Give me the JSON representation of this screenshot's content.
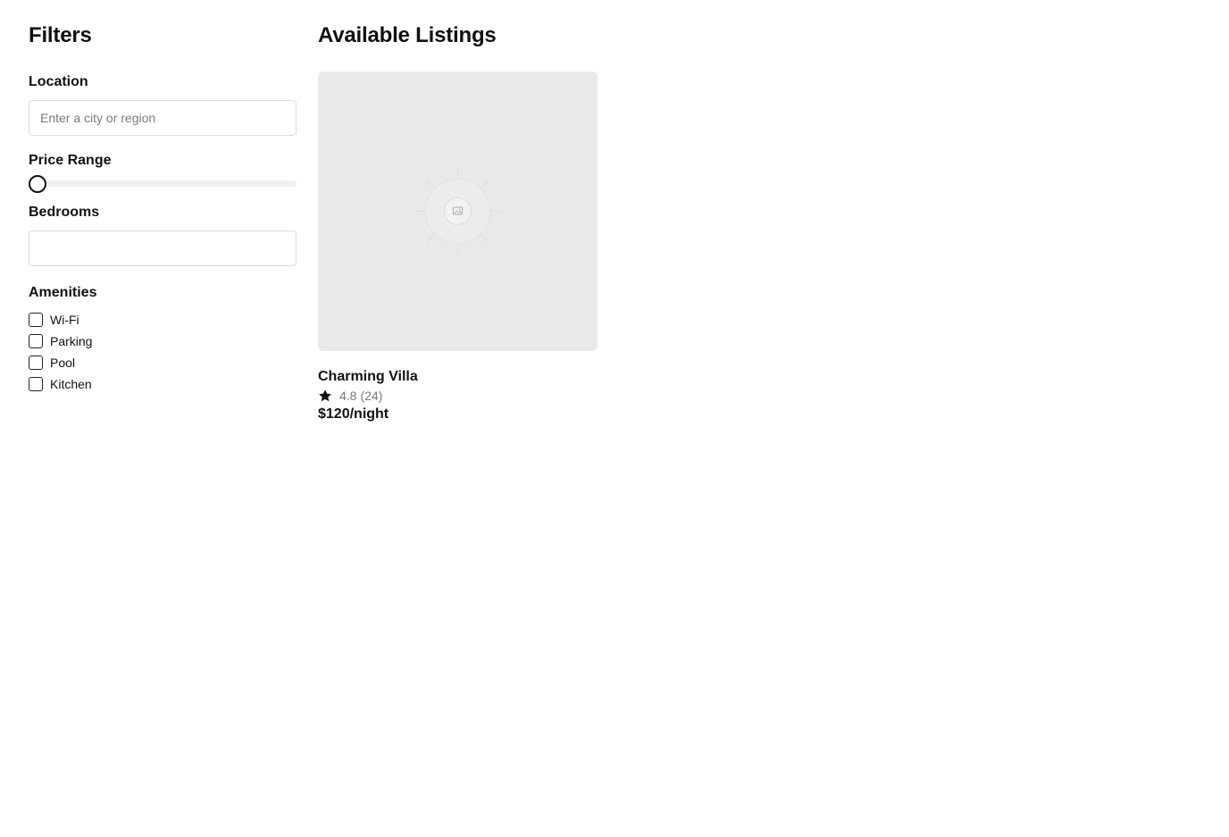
{
  "sidebar": {
    "title": "Filters",
    "location": {
      "label": "Location",
      "placeholder": "Enter a city or region",
      "value": ""
    },
    "price_range": {
      "label": "Price Range",
      "value_fraction": 0.0
    },
    "bedrooms": {
      "label": "Bedrooms",
      "value": ""
    },
    "amenities": {
      "label": "Amenities",
      "items": [
        {
          "label": "Wi-Fi",
          "checked": false
        },
        {
          "label": "Parking",
          "checked": false
        },
        {
          "label": "Pool",
          "checked": false
        },
        {
          "label": "Kitchen",
          "checked": false
        }
      ]
    }
  },
  "main": {
    "title": "Available Listings",
    "listings": [
      {
        "image_icon": "image-placeholder-icon",
        "title": "Charming Villa",
        "rating_icon": "star-icon",
        "rating": "4.8",
        "reviews": "(24)",
        "price": "$120/night"
      }
    ]
  },
  "colors": {
    "text": "#111111",
    "muted_text": "#777777",
    "placeholder_bg": "#e9e9e9",
    "border": "#dcdcdc",
    "track": "#f0f0f0"
  }
}
